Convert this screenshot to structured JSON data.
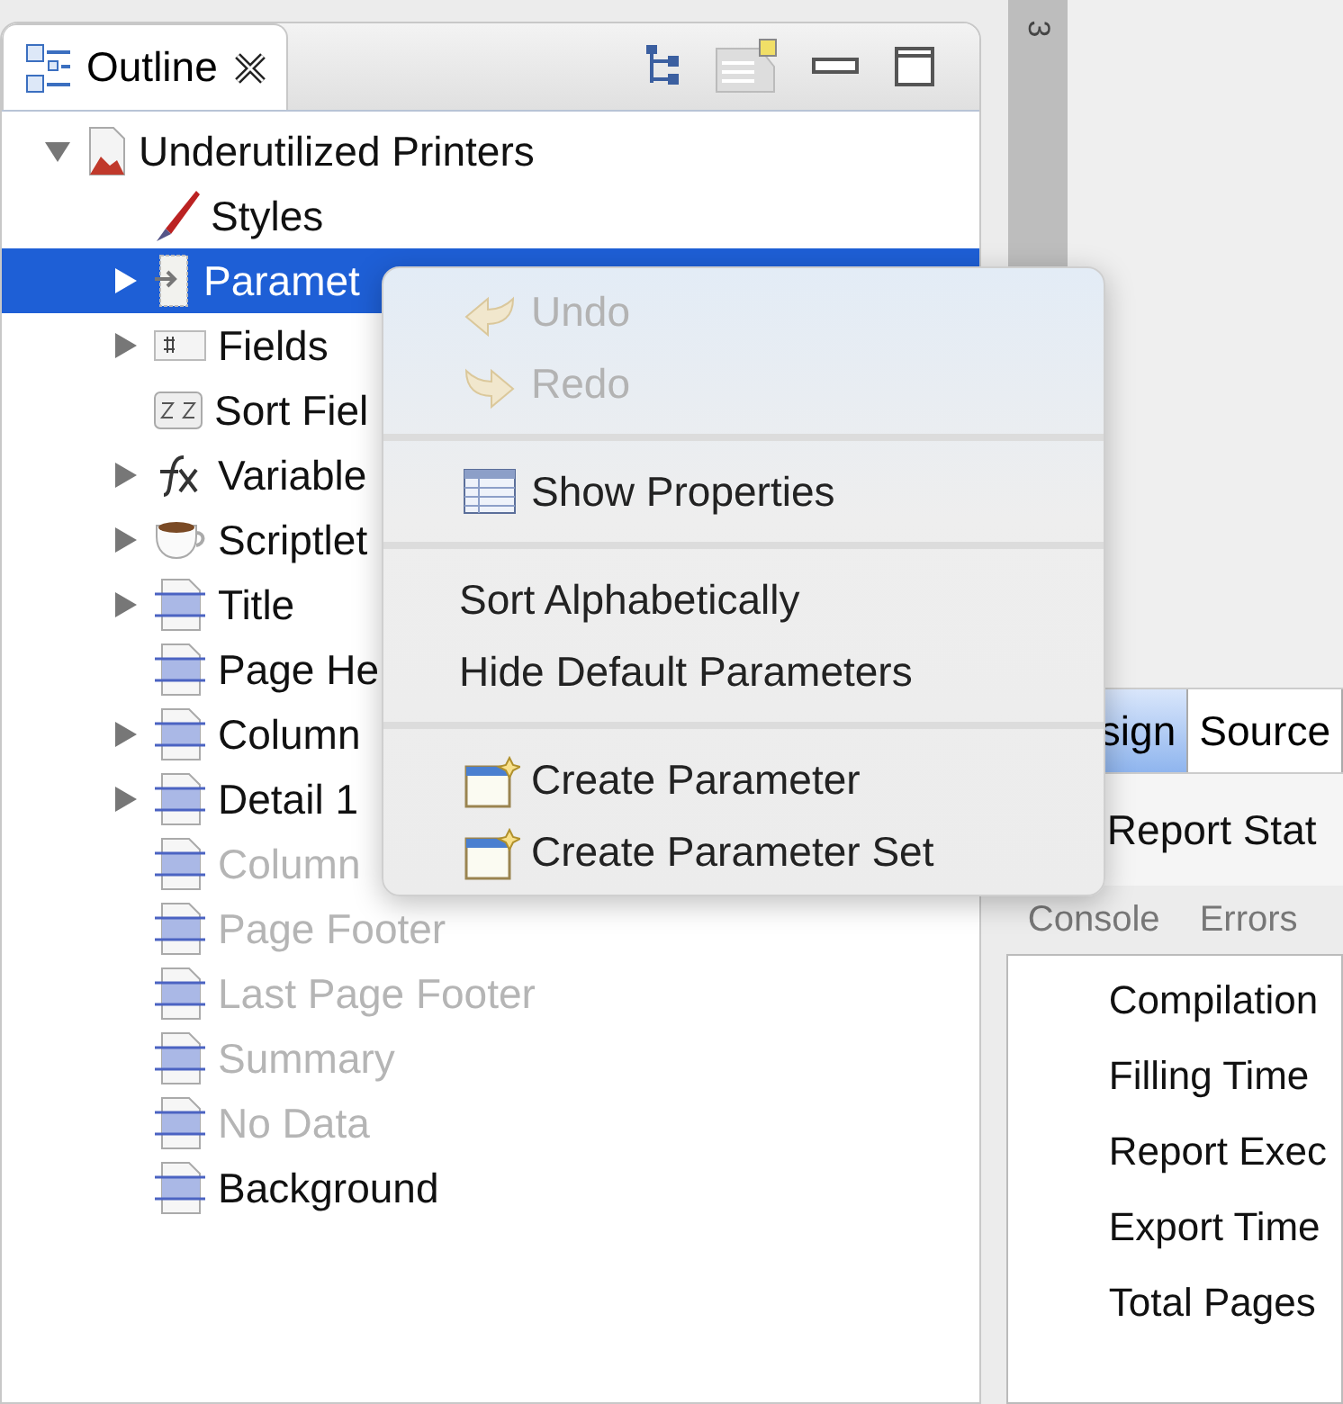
{
  "outline": {
    "tab": {
      "label": "Outline",
      "selected": true
    },
    "tree": [
      {
        "label": "Underutilized Printers",
        "kind": "report",
        "expanded": true,
        "selected": false,
        "disabled": false,
        "children": [
          {
            "label": "Styles",
            "kind": "styles",
            "selected": false,
            "disabled": false
          },
          {
            "label": "Paramet",
            "kind": "parameters",
            "expanded": false,
            "selected": true,
            "disabled": false
          },
          {
            "label": "Fields",
            "kind": "fields",
            "expanded": false,
            "selected": false,
            "disabled": false
          },
          {
            "label": "Sort Fiel",
            "kind": "sort",
            "selected": false,
            "disabled": false
          },
          {
            "label": "Variable",
            "kind": "variables",
            "expanded": false,
            "selected": false,
            "disabled": false
          },
          {
            "label": "Scriptlet",
            "kind": "scriptlets",
            "expanded": false,
            "selected": false,
            "disabled": false
          },
          {
            "label": "Title",
            "kind": "band",
            "expanded": false,
            "selected": false,
            "disabled": false
          },
          {
            "label": "Page He",
            "kind": "band",
            "selected": false,
            "disabled": false
          },
          {
            "label": "Column",
            "kind": "band",
            "expanded": false,
            "selected": false,
            "disabled": false
          },
          {
            "label": "Detail 1",
            "kind": "band",
            "expanded": false,
            "selected": false,
            "disabled": false
          },
          {
            "label": "Column",
            "kind": "band",
            "selected": false,
            "disabled": true
          },
          {
            "label": "Page Footer",
            "kind": "band",
            "selected": false,
            "disabled": true
          },
          {
            "label": "Last Page Footer",
            "kind": "band",
            "selected": false,
            "disabled": true
          },
          {
            "label": "Summary",
            "kind": "band",
            "selected": false,
            "disabled": true
          },
          {
            "label": "No Data",
            "kind": "band",
            "selected": false,
            "disabled": true
          },
          {
            "label": "Background",
            "kind": "band",
            "selected": false,
            "disabled": false
          }
        ]
      }
    ]
  },
  "editor": {
    "ruler_label": "3",
    "tabs": [
      {
        "label": "sign",
        "selected": true
      },
      {
        "label": "Source",
        "selected": false
      }
    ]
  },
  "report_state": {
    "title": "Report Stat",
    "tabs": [
      {
        "label": "Console",
        "selected": false
      },
      {
        "label": "Errors",
        "selected": false
      }
    ],
    "rows": [
      "Compilation",
      "Filling Time",
      "Report Exec",
      "Export Time",
      "Total Pages"
    ]
  },
  "context_menu": [
    {
      "kind": "undo",
      "label": "Undo",
      "disabled": true
    },
    {
      "kind": "redo",
      "label": "Redo",
      "disabled": true
    },
    {
      "kind": "separator"
    },
    {
      "kind": "properties",
      "label": "Show Properties",
      "disabled": false
    },
    {
      "kind": "separator"
    },
    {
      "kind": "plain",
      "label": "Sort Alphabetically",
      "disabled": false
    },
    {
      "kind": "plain",
      "label": "Hide Default Parameters",
      "disabled": false
    },
    {
      "kind": "separator"
    },
    {
      "kind": "create",
      "label": "Create Parameter",
      "disabled": false
    },
    {
      "kind": "create",
      "label": "Create Parameter Set",
      "disabled": false
    }
  ]
}
